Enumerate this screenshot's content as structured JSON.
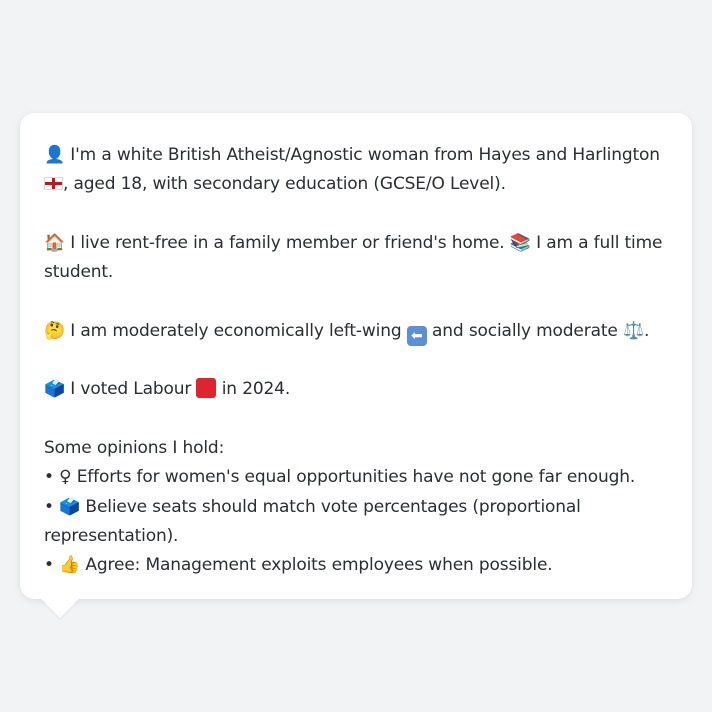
{
  "profile": {
    "line1": {
      "icon": "👤",
      "text_a": " I'm a white British Atheist/Agnostic woman from Hayes and Harlington ",
      "flag": "england-flag",
      "text_b": ", aged 18, with secondary education (GCSE/O Level)."
    },
    "line2": {
      "icon_home": "🏠",
      "text_a": " I live rent-free in a family member or friend's home. ",
      "icon_books": "📚",
      "text_b": " I am a full time student."
    },
    "line3": {
      "icon": "🤔",
      "text_a": " I am moderately economically left-wing ",
      "arrow_icon": "⬅",
      "text_b": " and socially moderate ",
      "scale_icon": "⚖️",
      "text_c": "."
    },
    "line4": {
      "icon": "🗳️",
      "text_a": " I voted Labour ",
      "party_color": "#e0242e",
      "text_b": " in 2024."
    },
    "opinions": {
      "heading": "Some opinions I hold:",
      "items": [
        {
          "bullet": "• ",
          "icon": "♀",
          "text": " Efforts for women's equal opportunities have not gone far enough."
        },
        {
          "bullet": "• ",
          "icon": "🗳️",
          "text": " Believe seats should match vote percentages (proportional representation)."
        },
        {
          "bullet": "• ",
          "icon": "👍",
          "text": " Agree: Management exploits employees when possible."
        }
      ]
    }
  }
}
